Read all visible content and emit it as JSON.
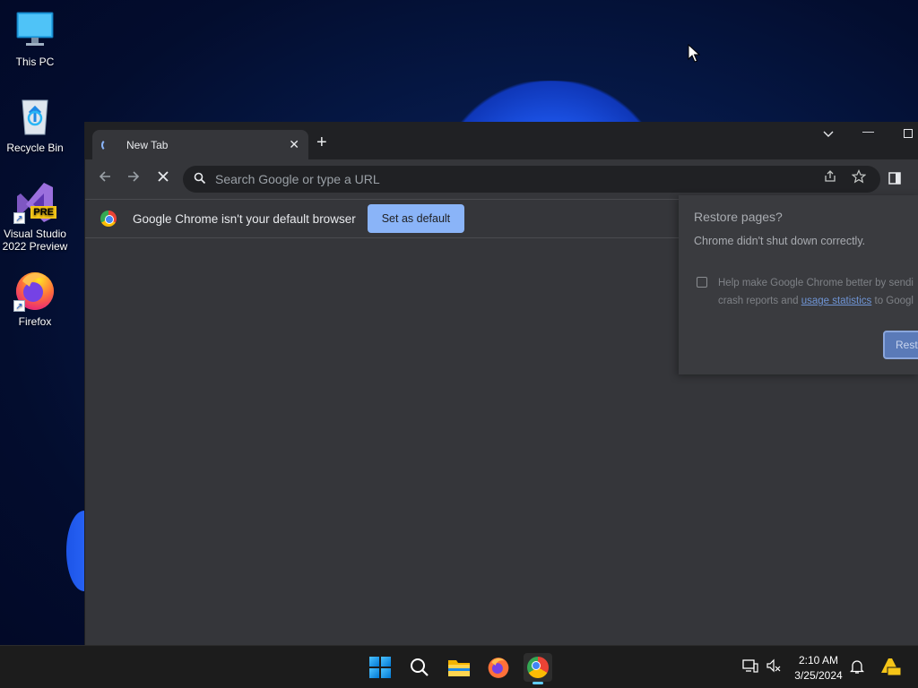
{
  "desktop": {
    "icons": [
      {
        "label": "This PC",
        "icon": "monitor-icon"
      },
      {
        "label": "Recycle Bin",
        "icon": "recycle-bin-icon"
      },
      {
        "label": "Visual Studio 2022 Preview",
        "icon": "visual-studio-icon",
        "badge": "PRE"
      },
      {
        "label": "Firefox",
        "icon": "firefox-icon"
      }
    ]
  },
  "browser": {
    "tab_title": "New Tab",
    "omnibox_placeholder": "Search Google or type a URL",
    "infobar": {
      "message": "Google Chrome isn't your default browser",
      "button": "Set as default"
    },
    "restore_bubble": {
      "title": "Restore pages?",
      "message": "Chrome didn't shut down correctly.",
      "help_line1": "Help make Google Chrome better by sendi",
      "help_line2_prefix": "crash reports and ",
      "help_link": "usage statistics",
      "help_line2_suffix": " to Googl",
      "button": "Resto"
    },
    "accent": "#8ab4f8"
  },
  "taskbar": {
    "time": "2:10 AM",
    "date": "3/25/2024",
    "apps": [
      "start-icon",
      "search-icon",
      "file-explorer-icon",
      "firefox-icon",
      "chrome-icon"
    ],
    "active_app": "chrome-icon"
  }
}
